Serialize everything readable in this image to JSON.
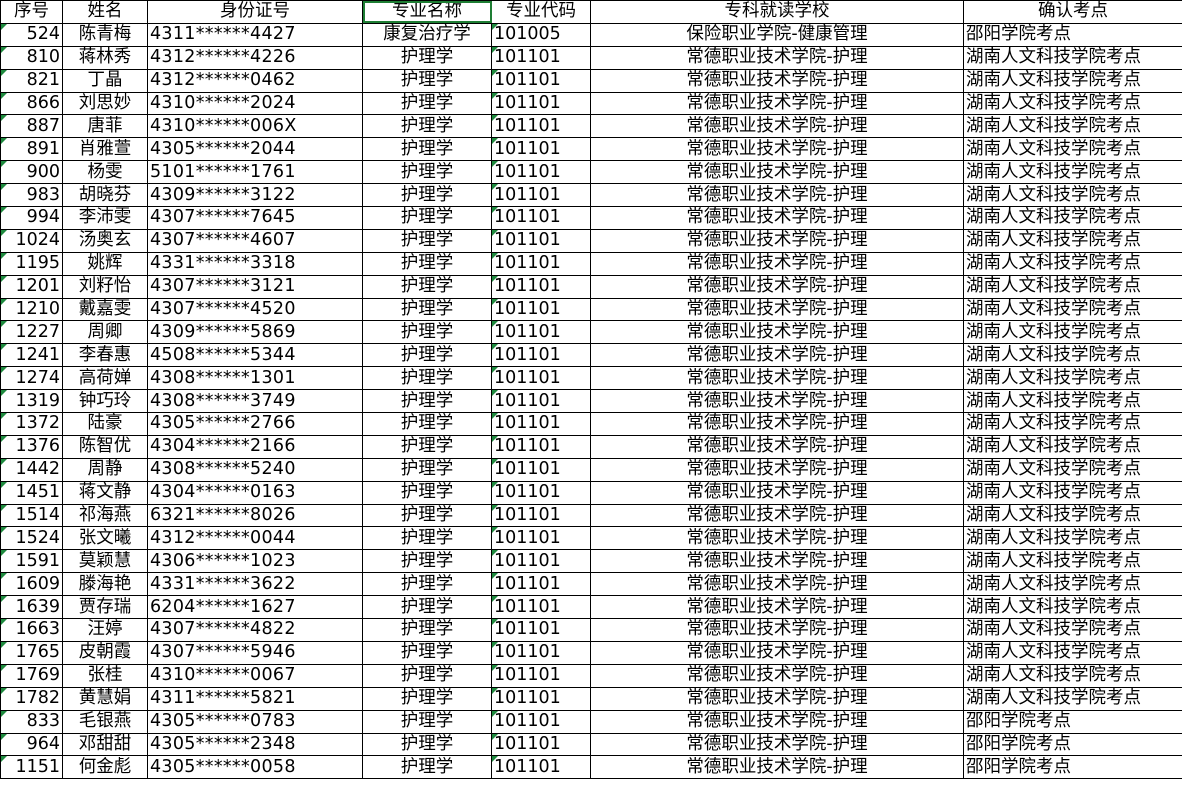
{
  "headers": [
    "序号",
    "姓名",
    "身份证号",
    "专业名称",
    "专业代码",
    "专科就读学校",
    "确认考点"
  ],
  "rows": [
    [
      "524",
      "陈青梅",
      "4311******4427",
      "康复治疗学",
      "101005",
      "保险职业学院-健康管理",
      "邵阳学院考点"
    ],
    [
      "810",
      "蒋林秀",
      "4312******4226",
      "护理学",
      "101101",
      "常德职业技术学院-护理",
      "湖南人文科技学院考点"
    ],
    [
      "821",
      "丁晶",
      "4312******0462",
      "护理学",
      "101101",
      "常德职业技术学院-护理",
      "湖南人文科技学院考点"
    ],
    [
      "866",
      "刘思妙",
      "4310******2024",
      "护理学",
      "101101",
      "常德职业技术学院-护理",
      "湖南人文科技学院考点"
    ],
    [
      "887",
      "唐菲",
      "4310******006X",
      "护理学",
      "101101",
      "常德职业技术学院-护理",
      "湖南人文科技学院考点"
    ],
    [
      "891",
      "肖雅萱",
      "4305******2044",
      "护理学",
      "101101",
      "常德职业技术学院-护理",
      "湖南人文科技学院考点"
    ],
    [
      "900",
      "杨雯",
      "5101******1761",
      "护理学",
      "101101",
      "常德职业技术学院-护理",
      "湖南人文科技学院考点"
    ],
    [
      "983",
      "胡晓芬",
      "4309******3122",
      "护理学",
      "101101",
      "常德职业技术学院-护理",
      "湖南人文科技学院考点"
    ],
    [
      "994",
      "李沛雯",
      "4307******7645",
      "护理学",
      "101101",
      "常德职业技术学院-护理",
      "湖南人文科技学院考点"
    ],
    [
      "1024",
      "汤奥玄",
      "4307******4607",
      "护理学",
      "101101",
      "常德职业技术学院-护理",
      "湖南人文科技学院考点"
    ],
    [
      "1195",
      "姚辉",
      "4331******3318",
      "护理学",
      "101101",
      "常德职业技术学院-护理",
      "湖南人文科技学院考点"
    ],
    [
      "1201",
      "刘籽怡",
      "4307******3121",
      "护理学",
      "101101",
      "常德职业技术学院-护理",
      "湖南人文科技学院考点"
    ],
    [
      "1210",
      "戴嘉雯",
      "4307******4520",
      "护理学",
      "101101",
      "常德职业技术学院-护理",
      "湖南人文科技学院考点"
    ],
    [
      "1227",
      "周卿",
      "4309******5869",
      "护理学",
      "101101",
      "常德职业技术学院-护理",
      "湖南人文科技学院考点"
    ],
    [
      "1241",
      "李春惠",
      "4508******5344",
      "护理学",
      "101101",
      "常德职业技术学院-护理",
      "湖南人文科技学院考点"
    ],
    [
      "1274",
      "高荷婵",
      "4308******1301",
      "护理学",
      "101101",
      "常德职业技术学院-护理",
      "湖南人文科技学院考点"
    ],
    [
      "1319",
      "钟巧玲",
      "4308******3749",
      "护理学",
      "101101",
      "常德职业技术学院-护理",
      "湖南人文科技学院考点"
    ],
    [
      "1372",
      "陆豪",
      "4305******2766",
      "护理学",
      "101101",
      "常德职业技术学院-护理",
      "湖南人文科技学院考点"
    ],
    [
      "1376",
      "陈智优",
      "4304******2166",
      "护理学",
      "101101",
      "常德职业技术学院-护理",
      "湖南人文科技学院考点"
    ],
    [
      "1442",
      "周静",
      "4308******5240",
      "护理学",
      "101101",
      "常德职业技术学院-护理",
      "湖南人文科技学院考点"
    ],
    [
      "1451",
      "蒋文静",
      "4304******0163",
      "护理学",
      "101101",
      "常德职业技术学院-护理",
      "湖南人文科技学院考点"
    ],
    [
      "1514",
      "祁海燕",
      "6321******8026",
      "护理学",
      "101101",
      "常德职业技术学院-护理",
      "湖南人文科技学院考点"
    ],
    [
      "1524",
      "张文曦",
      "4312******0044",
      "护理学",
      "101101",
      "常德职业技术学院-护理",
      "湖南人文科技学院考点"
    ],
    [
      "1591",
      "莫颖慧",
      "4306******1023",
      "护理学",
      "101101",
      "常德职业技术学院-护理",
      "湖南人文科技学院考点"
    ],
    [
      "1609",
      "滕海艳",
      "4331******3622",
      "护理学",
      "101101",
      "常德职业技术学院-护理",
      "湖南人文科技学院考点"
    ],
    [
      "1639",
      "贾存瑞",
      "6204******1627",
      "护理学",
      "101101",
      "常德职业技术学院-护理",
      "湖南人文科技学院考点"
    ],
    [
      "1663",
      "汪婷",
      "4307******4822",
      "护理学",
      "101101",
      "常德职业技术学院-护理",
      "湖南人文科技学院考点"
    ],
    [
      "1765",
      "皮朝霞",
      "4307******5946",
      "护理学",
      "101101",
      "常德职业技术学院-护理",
      "湖南人文科技学院考点"
    ],
    [
      "1769",
      "张桂",
      "4310******0067",
      "护理学",
      "101101",
      "常德职业技术学院-护理",
      "湖南人文科技学院考点"
    ],
    [
      "1782",
      "黄慧娟",
      "4311******5821",
      "护理学",
      "101101",
      "常德职业技术学院-护理",
      "湖南人文科技学院考点"
    ],
    [
      "833",
      "毛银燕",
      "4305******0783",
      "护理学",
      "101101",
      "常德职业技术学院-护理",
      "邵阳学院考点"
    ],
    [
      "964",
      "邓甜甜",
      "4305******2348",
      "护理学",
      "101101",
      "常德职业技术学院-护理",
      "邵阳学院考点"
    ],
    [
      "1151",
      "何金彪",
      "4305******0058",
      "护理学",
      "101101",
      "常德职业技术学院-护理",
      "邵阳学院考点"
    ]
  ]
}
